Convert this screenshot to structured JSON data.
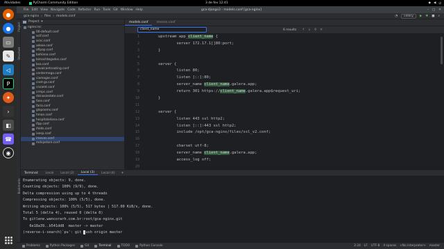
{
  "topbar": {
    "activities": "Atividades",
    "app": "PyCharm Community Edition",
    "clock": "3 de fev 12:41"
  },
  "window": {
    "menu": [
      "File",
      "Edit",
      "View",
      "Navigate",
      "Code",
      "Refactor",
      "Run",
      "Tools",
      "Git",
      "Window",
      "Help"
    ],
    "title": "gca-django3 - models.conf [gca-nginx]"
  },
  "navbar": {
    "crumbs": [
      "gca-nginx",
      "files",
      "models.conf"
    ],
    "run_config": "celery"
  },
  "project": {
    "header": "Project",
    "items": [
      "nginx.inc",
      "00-default.conf",
      "acif.conf",
      "acsc.conf",
      "adexe.conf",
      "afipap.conf",
      "bahiana.conf",
      "bimachtegados.conf",
      "bsa.conf",
      "cavalcantcoating.conf",
      "centermega.conf",
      "ciamagas.conf",
      "cnet-gs.conf",
      "cnsamt.conf",
      "crmpc.conf",
      "dsinasiestate.conf",
      "fase.conf",
      "faria.conf",
      "glopooms.conf",
      "hman.conf",
      "hospitalaliana.conf",
      "ifpp.conf",
      "ifolds.conf",
      "ixesp.conf",
      "imeves.conf",
      "mdvpetore.conf"
    ],
    "selected_index": 24
  },
  "editor": {
    "tabs": [
      "models.conf",
      "imesex.conf"
    ],
    "active_tab": 0,
    "find_query": "client_name",
    "find_results": "6 results",
    "gutter": [
      "1",
      "2",
      "3",
      "4",
      "5",
      "6",
      "7",
      "8",
      "9",
      "10",
      "11",
      "12",
      "13",
      "14",
      "15",
      "16",
      "17",
      "18",
      "19",
      "20"
    ],
    "lines": [
      [
        [
          "upstream app_",
          ""
        ],
        [
          "client_name",
          "hl"
        ],
        [
          " {",
          ""
        ]
      ],
      [
        [
          "        server 172.17.1",
          ""
        ],
        [
          "[]",
          ""
        ],
        [
          "80:port;",
          ""
        ]
      ],
      [
        [
          "}",
          ""
        ]
      ],
      [
        [
          "",
          ""
        ]
      ],
      [
        [
          "server {",
          ""
        ]
      ],
      [
        [
          "        listen 80;",
          ""
        ]
      ],
      [
        [
          "        listen [::]:80;",
          ""
        ]
      ],
      [
        [
          "        server_name ",
          ""
        ],
        [
          "client_name",
          "hl"
        ],
        [
          ".galera.app;",
          ""
        ]
      ],
      [
        [
          "        return 301 https://",
          ""
        ],
        [
          "client_name",
          "hl"
        ],
        [
          ".galera.app$request_uri;",
          ""
        ]
      ],
      [
        [
          "}",
          ""
        ]
      ],
      [
        [
          "",
          ""
        ]
      ],
      [
        [
          "server {",
          ""
        ]
      ],
      [
        [
          "        listen 443 ssl http2;",
          ""
        ]
      ],
      [
        [
          "        listen [::]:443 ssl http2;",
          ""
        ]
      ],
      [
        [
          "        include /opt/gca-nginx/files/ssl_v2.conf;",
          ""
        ]
      ],
      [
        [
          "",
          ""
        ]
      ],
      [
        [
          "        charset utf-8;",
          ""
        ]
      ],
      [
        [
          "        server_name ",
          ""
        ],
        [
          "client_name",
          "hl"
        ],
        [
          ".galera.app;",
          ""
        ]
      ],
      [
        [
          "        access_log off;",
          ""
        ]
      ],
      [
        [
          "",
          ""
        ]
      ]
    ]
  },
  "terminal": {
    "tabs": [
      "Terminal:",
      "Local",
      "Local (2)",
      "Local (3)",
      "Local (4)"
    ],
    "active_tab": 3,
    "lines": [
      "Enumerating objects: 9, done.",
      "Counting objects: 100% (9/9), done.",
      "Delta compression using up to 4 threads",
      "Compressing objects: 100% (5/5), done.",
      "Writing objects: 100% (5/5), 517 bytes | 517.00 KiB/s, done.",
      "Total 5 (delta 4), reused 0 (delta 0)",
      "To gitlene.wancorarh.com.br:root/gca-nginx.git",
      "   6e18a39..b541dd8  master -> master"
    ],
    "prompt_before": "(reverse-i-search)`pu': git ",
    "prompt_after": "ush origin master"
  },
  "bottom": {
    "tools": [
      "Problems",
      "Python Packages",
      "Git",
      "Terminal",
      "TODO",
      "Python Console"
    ],
    "active_tool": 3,
    "status": [
      "2:24",
      "LF",
      "UTF-8",
      "4 spaces",
      "<No interpreter>",
      "master"
    ]
  }
}
